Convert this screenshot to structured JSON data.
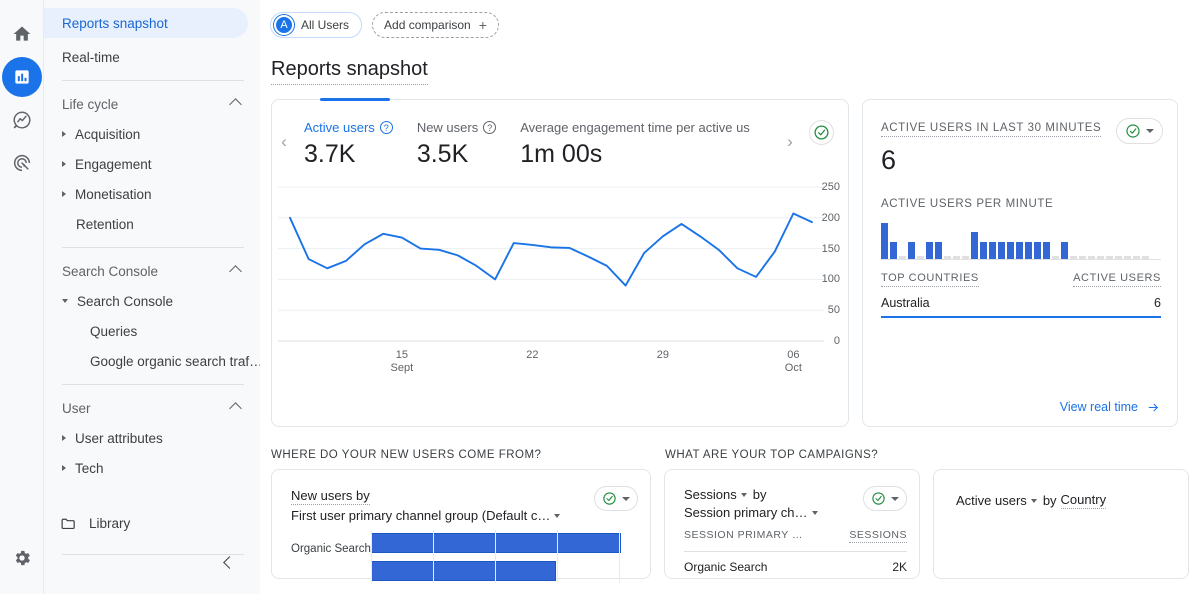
{
  "rail": {
    "items": [
      {
        "name": "home-icon",
        "label": "Home"
      },
      {
        "name": "reports-icon",
        "label": "Reports"
      },
      {
        "name": "explore-icon",
        "label": "Explore"
      },
      {
        "name": "advertising-icon",
        "label": "Advertising"
      }
    ],
    "settings_label": "Admin"
  },
  "sidebar": {
    "top_items": [
      {
        "label": "Reports snapshot",
        "selected": true
      },
      {
        "label": "Real-time",
        "selected": false
      }
    ],
    "groups": [
      {
        "title": "Life cycle",
        "items": [
          {
            "label": "Acquisition",
            "expandable": true
          },
          {
            "label": "Engagement",
            "expandable": true
          },
          {
            "label": "Monetisation",
            "expandable": true
          },
          {
            "label": "Retention",
            "expandable": false
          }
        ]
      },
      {
        "title": "Search Console",
        "items": [
          {
            "label": "Search Console",
            "expandable": true,
            "expanded": true
          },
          {
            "label": "Queries",
            "expandable": false,
            "sub": true
          },
          {
            "label": "Google organic search traf…",
            "expandable": false,
            "sub": true
          }
        ]
      },
      {
        "title": "User",
        "items": [
          {
            "label": "User attributes",
            "expandable": true
          },
          {
            "label": "Tech",
            "expandable": true
          }
        ]
      }
    ],
    "library_label": "Library",
    "collapse_label": "Collapse navigation"
  },
  "topbar": {
    "all_users_chip": "All Users",
    "all_users_avatar": "A",
    "add_comparison": "Add comparison"
  },
  "page_title": "Reports snapshot",
  "overview_card": {
    "metrics": [
      {
        "label": "Active users",
        "value": "3.7K",
        "active": true
      },
      {
        "label": "New users",
        "value": "3.5K",
        "active": false
      },
      {
        "label": "Average engagement time per active us",
        "value": "1m 00s",
        "active": false
      }
    ],
    "prev_label": "Previous metrics",
    "next_label": "Next metrics",
    "insights_label": "Insights"
  },
  "realtime_card": {
    "headline_label": "ACTIVE USERS IN LAST 30 MINUTES",
    "headline_value": "6",
    "per_minute_label": "ACTIVE USERS PER MINUTE",
    "countries_header": "TOP COUNTRIES",
    "active_users_header": "ACTIVE USERS",
    "rows": [
      {
        "country": "Australia",
        "users": "6"
      }
    ],
    "view_link": "View real time"
  },
  "sections": [
    {
      "title": "WHERE DO YOUR NEW USERS COME FROM?"
    },
    {
      "title": "WHAT ARE YOUR TOP CAMPAIGNS?"
    }
  ],
  "new_users_card": {
    "title_line1": "New users by",
    "title_line2": "First user primary channel group (Default c…",
    "rows": [
      {
        "label": "Organic Search"
      }
    ]
  },
  "campaigns_card": {
    "metric": "Sessions",
    "by": "by",
    "dimension": "Session primary ch…",
    "col_dimension": "SESSION PRIMARY …",
    "col_metric": "SESSIONS",
    "rows": [
      {
        "label": "Organic Search",
        "value": "2K"
      }
    ]
  },
  "geo_card": {
    "metric": "Active users",
    "by": "by",
    "dimension": "Country"
  },
  "colors": {
    "accent": "#1a73e8",
    "line": "#1a73e8",
    "bar": "#3367d6",
    "green": "#1e8e3e",
    "sidebar_bg": "#f8f9fa",
    "selected_bg": "#e8f0fe"
  },
  "chart_data": [
    {
      "type": "line",
      "title": "Active users over time",
      "xlabel": "",
      "ylabel": "",
      "ylim": [
        0,
        250
      ],
      "yticks": [
        0,
        50,
        100,
        150,
        200,
        250
      ],
      "grid": true,
      "x_tick_labels": [
        {
          "day": "15",
          "month": "Sept"
        },
        {
          "day": "22",
          "month": ""
        },
        {
          "day": "29",
          "month": ""
        },
        {
          "day": "06",
          "month": "Oct"
        }
      ],
      "series": [
        {
          "name": "Active users",
          "values": [
            200,
            133,
            118,
            130,
            157,
            174,
            168,
            150,
            148,
            139,
            122,
            100,
            159,
            156,
            152,
            151,
            137,
            122,
            90,
            143,
            170,
            190,
            170,
            148,
            118,
            104,
            145,
            207,
            193
          ]
        }
      ]
    },
    {
      "type": "bar",
      "title": "Active users per minute",
      "ylim": [
        0,
        3
      ],
      "values": [
        3,
        1,
        0,
        1,
        0,
        1,
        1,
        0,
        0,
        0,
        2,
        1,
        1,
        1,
        1,
        1,
        1,
        1,
        1,
        0,
        1,
        0,
        0,
        0,
        0,
        0,
        0,
        0,
        0,
        0
      ],
      "categories": []
    },
    {
      "type": "bar",
      "title": "New users by first user primary channel group",
      "orientation": "horizontal",
      "categories": [
        "Organic Search"
      ],
      "values": [
        100
      ]
    }
  ]
}
